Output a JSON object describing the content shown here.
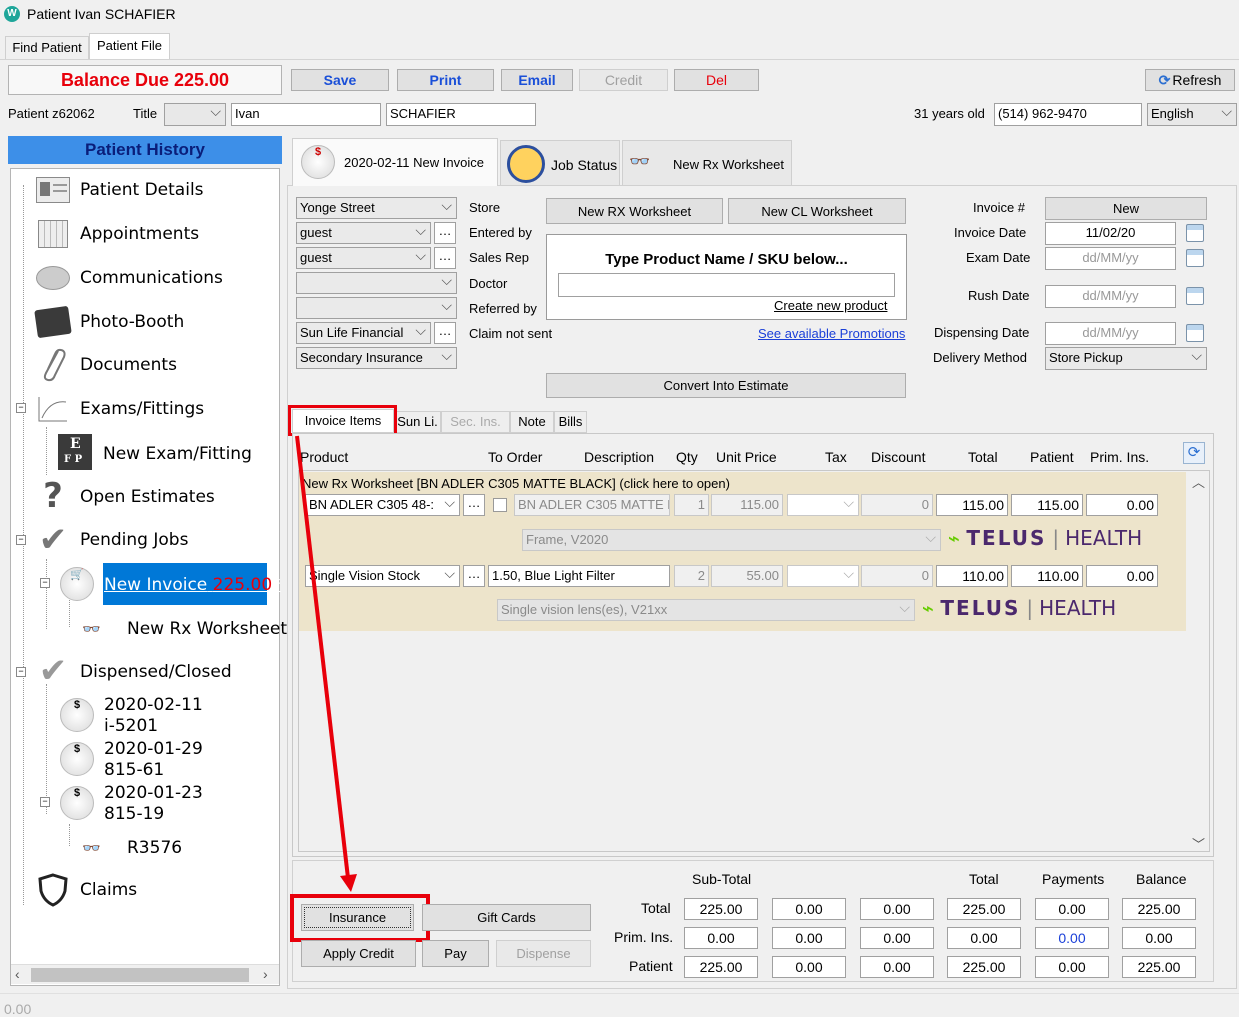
{
  "window": {
    "title": "Patient Ivan SCHAFIER"
  },
  "tabs": [
    {
      "label": "Find Patient"
    },
    {
      "label": "Patient File"
    }
  ],
  "toolbar": {
    "balance_due": "Balance Due 225.00",
    "save": "Save",
    "print": "Print",
    "email": "Email",
    "credit": "Credit",
    "del": "Del",
    "refresh": "Refresh"
  },
  "patient": {
    "id_label": "Patient z62062",
    "title_label": "Title",
    "title_value": "",
    "first_name": "Ivan",
    "last_name": "SCHAFIER",
    "age": "31 years old",
    "phone": "(514) 962-9470",
    "language": "English"
  },
  "history": {
    "header": "Patient History",
    "items": {
      "details": "Patient Details",
      "appointments": "Appointments",
      "communications": "Communications",
      "photobooth": "Photo-Booth",
      "documents": "Documents",
      "exams": "Exams/Fittings",
      "new_exam": "New Exam/Fitting",
      "estimates": "Open Estimates",
      "pending": "Pending Jobs",
      "new_invoice": "New Invoice",
      "new_invoice_amount": "225.00",
      "new_invoice_star": "*",
      "new_rx": "New Rx Worksheet*",
      "dispensed": "Dispensed/Closed",
      "inv1_date": "2020-02-11",
      "inv1_id": "i-5201",
      "inv2_date": "2020-01-29",
      "inv2_id": "815-61",
      "inv3_date": "2020-01-23",
      "inv3_id": "815-19",
      "r3576": "R3576",
      "claims": "Claims"
    }
  },
  "doc_tabs": {
    "invoice": "2020-02-11 New Invoice",
    "job_status": "Job Status",
    "rx_worksheet": "New Rx Worksheet"
  },
  "form": {
    "store_value": "Yonge Street",
    "store_label": "Store",
    "entered_value": "guest",
    "entered_label": "Entered by",
    "salesrep_value": "guest",
    "salesrep_label": "Sales Rep",
    "doctor_label": "Doctor",
    "referred_label": "Referred by",
    "insurance_value": "Sun Life Financial",
    "claim_label": "Claim not sent",
    "secondary_value": "Secondary Insurance",
    "new_rx_btn": "New RX Worksheet",
    "new_cl_btn": "New CL Worksheet",
    "product_prompt": "Type Product Name / SKU below...",
    "create_product": "Create new product",
    "promotions": "See available Promotions",
    "convert": "Convert Into Estimate",
    "invoice_no_label": "Invoice #",
    "invoice_no": "New",
    "invoice_date_label": "Invoice Date",
    "invoice_date": "11/02/20",
    "exam_date_label": "Exam Date",
    "exam_date": "dd/MM/yy",
    "rush_date_label": "Rush Date",
    "rush_date": "dd/MM/yy",
    "disp_date_label": "Dispensing Date",
    "disp_date": "dd/MM/yy",
    "delivery_label": "Delivery Method",
    "delivery": "Store Pickup"
  },
  "item_tabs": [
    "Invoice Items",
    "Sun Li.",
    "Sec. Ins.",
    "Note",
    "Bills"
  ],
  "items_table": {
    "headers": [
      "Product",
      "To Order",
      "Description",
      "Qty",
      "Unit Price",
      "Tax",
      "Discount",
      "Total",
      "Patient",
      "Prim. Ins."
    ],
    "group_title": "New Rx Worksheet [BN ADLER C305 MATTE BLACK] (click here to open)",
    "rows": [
      {
        "product": "BN ADLER C305  48-:",
        "description": "BN ADLER C305 MATTE B",
        "qty": "1",
        "unit": "115.00",
        "discount": "0",
        "total": "115.00",
        "patient": "115.00",
        "prim": "0.00",
        "sub": "Frame, V2020"
      },
      {
        "product": "Single Vision Stock",
        "description": "1.50, Blue Light Filter",
        "qty": "2",
        "unit": "55.00",
        "discount": "0",
        "total": "110.00",
        "patient": "110.00",
        "prim": "0.00",
        "sub": "Single vision lens(es), V21xx"
      }
    ],
    "telus_word": "TELUS",
    "telus_health": "HEALTH"
  },
  "bottom_buttons": {
    "insurance": "Insurance",
    "gift": "Gift Cards",
    "apply_credit": "Apply Credit",
    "pay": "Pay",
    "dispense": "Dispense"
  },
  "totals": {
    "headers": [
      "Sub-Total",
      "Total",
      "Payments",
      "Balance"
    ],
    "row_labels": [
      "Total",
      "Prim. Ins.",
      "Patient"
    ],
    "rows": [
      [
        "225.00",
        "0.00",
        "0.00",
        "225.00",
        "0.00",
        "225.00"
      ],
      [
        "0.00",
        "0.00",
        "0.00",
        "0.00",
        "0.00",
        "0.00"
      ],
      [
        "225.00",
        "0.00",
        "0.00",
        "225.00",
        "0.00",
        "225.00"
      ]
    ]
  },
  "status_bar": "0.00",
  "colors": {
    "accent_red": "#e8000b",
    "history_blue": "#3d8fe8",
    "highlight": "#0078d7",
    "row_bg": "#ede4cb"
  }
}
